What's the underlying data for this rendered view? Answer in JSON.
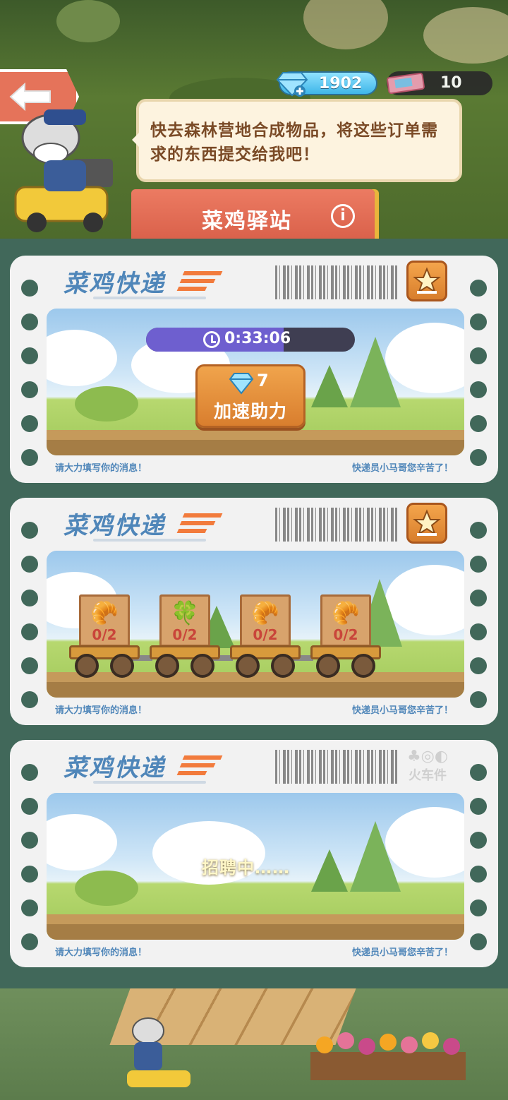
{
  "currency": {
    "gems": "1902",
    "tickets": "10"
  },
  "npc": {
    "speech": "快去森林营地合成物品，将这些订单需求的东西提交给我吧！"
  },
  "header": {
    "title": "菜鸡驿站"
  },
  "cards": [
    {
      "title": "菜鸡快递",
      "timer": "0:33:06",
      "boost_cost": "7",
      "boost_label": "加速助力",
      "footer_left": "请大力填写你的消息！",
      "footer_right": "快递员小马哥您辛苦了！"
    },
    {
      "title": "菜鸡快递",
      "carts": [
        {
          "item_icon": "croissant-icon",
          "count": "0/2"
        },
        {
          "item_icon": "clover-icon",
          "count": "0/2"
        },
        {
          "item_icon": "croissant-icon",
          "count": "0/2"
        },
        {
          "item_icon": "croissant-icon",
          "count": "0/2"
        }
      ],
      "footer_left": "请大力填写你的消息！",
      "footer_right": "快递员小马哥您辛苦了！"
    },
    {
      "title": "菜鸡快递",
      "wagon_label": "火车件",
      "status": "招聘中……",
      "footer_left": "请大力填写你的消息！",
      "footer_right": "快递员小马哥您辛苦了！"
    }
  ],
  "colors": {
    "panel_bg": "#41685a",
    "accent_orange": "#f27b3c",
    "title_blue": "#4f86b9",
    "banner_red": "#e5735a"
  }
}
